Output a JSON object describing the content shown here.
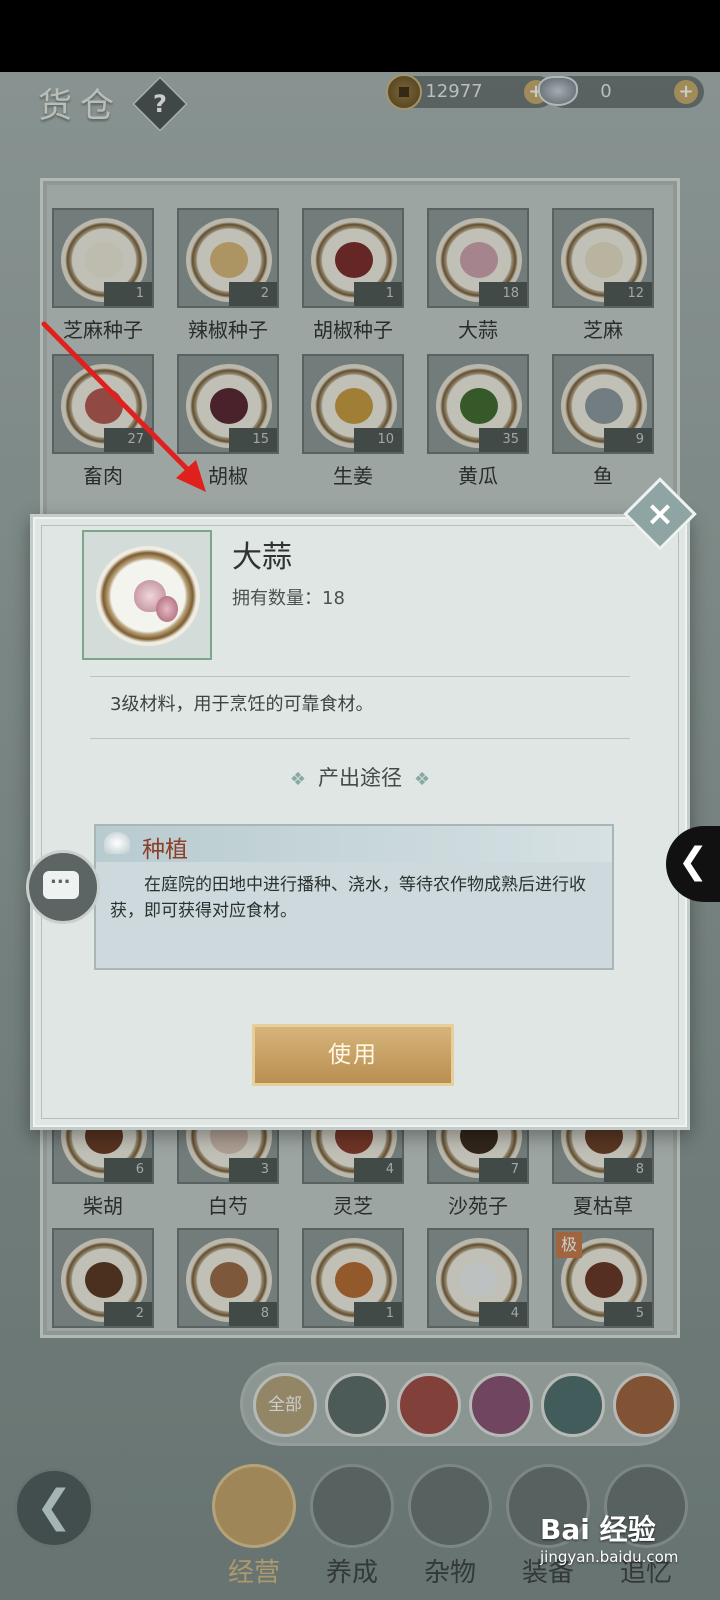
{
  "header": {
    "title": "货仓",
    "help_glyph": "?"
  },
  "currency": {
    "coins": "12977",
    "ingots": "0",
    "plus": "+"
  },
  "grid_top_row1": [
    {
      "name": "芝麻种子",
      "count": "1"
    },
    {
      "name": "辣椒种子",
      "count": "2"
    },
    {
      "name": "胡椒种子",
      "count": "1"
    },
    {
      "name": "大蒜",
      "count": "18"
    },
    {
      "name": "芝麻",
      "count": "12"
    }
  ],
  "grid_top_row2": [
    {
      "name": "畜肉",
      "count": "27"
    },
    {
      "name": "胡椒",
      "count": "15"
    },
    {
      "name": "生姜",
      "count": "10"
    },
    {
      "name": "黄瓜",
      "count": "35"
    },
    {
      "name": "鱼",
      "count": "9"
    }
  ],
  "grid_bottom_row1": [
    {
      "name": "柴胡",
      "count": "6"
    },
    {
      "name": "白芍",
      "count": "3"
    },
    {
      "name": "灵芝",
      "count": "4"
    },
    {
      "name": "沙苑子",
      "count": "7"
    },
    {
      "name": "夏枯草",
      "count": "8"
    }
  ],
  "grid_bottom_row2": [
    {
      "count": "2"
    },
    {
      "count": "8"
    },
    {
      "count": "1"
    },
    {
      "count": "4"
    },
    {
      "count": "5",
      "tag": "极"
    }
  ],
  "filters": {
    "all_label": "全部"
  },
  "bottom_nav": [
    "经营",
    "养成",
    "杂物",
    "装备",
    "追忆"
  ],
  "dialog": {
    "item_name": "大蒜",
    "count_label": "拥有数量：18",
    "description": "3级材料，用于烹饪的可靠食材。",
    "section_title": "产出途径",
    "section_decoration": "❖",
    "source_title": "种植",
    "source_text": "在庭院的田地中进行播种、浇水，等待农作物成熟后进行收获，即可获得对应食材。",
    "use_button": "使用",
    "close_glyph": "×"
  },
  "watermark": {
    "brand": "Bai 经验",
    "url": "jingyan.baidu.com"
  },
  "colors": {
    "accent_gold": "#c6a56b",
    "source_title_red": "#8b3f27",
    "annotation_arrow": "#e0201c"
  }
}
